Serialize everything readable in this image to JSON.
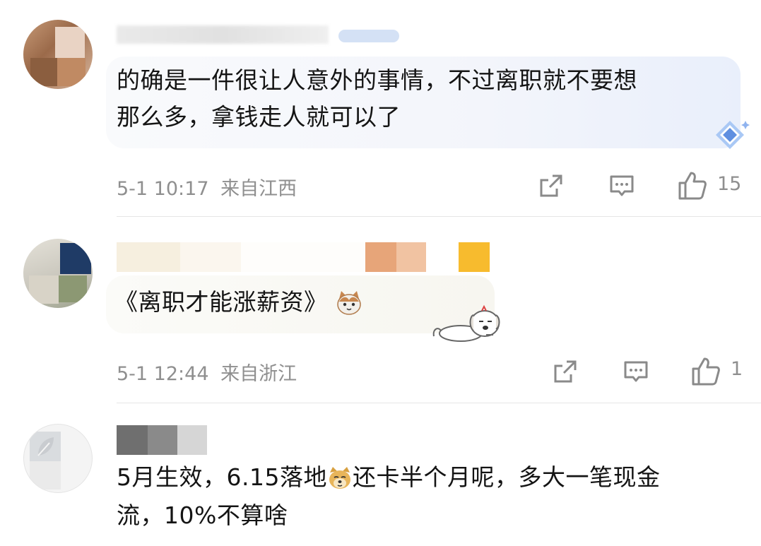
{
  "comments": [
    {
      "text_line1": "的确是一件很让人意外的事情，不过离职就不要想",
      "text_line2": "那么多，拿钱走人就可以了",
      "time": "5-1 10:17",
      "location": "来自江西",
      "likes": "15",
      "avatar_icon": "avatar-photo",
      "bubble_badge_icon": "diamond-badge-icon"
    },
    {
      "text": "《离职才能涨薪资》",
      "time": "5-1 12:44",
      "location": "来自浙江",
      "likes": "1",
      "emoji_icon": "cat-face-emoji",
      "sticker_icon": "sleepy-dog-sticker"
    },
    {
      "text_part1": "5月生效，6.15落地",
      "text_part2": "还卡半个月呢，多大一笔现金",
      "text_line2": "流，10%不算啥",
      "emoji_icon": "doge-emoji"
    }
  ],
  "actions": {
    "share_icon": "share-icon",
    "comment_icon": "comment-icon",
    "like_icon": "thumbs-up-icon"
  },
  "colors": {
    "meta_text": "#8f8f8f",
    "divider": "#e6e6e6",
    "bubble_tint": "#e9effb"
  }
}
